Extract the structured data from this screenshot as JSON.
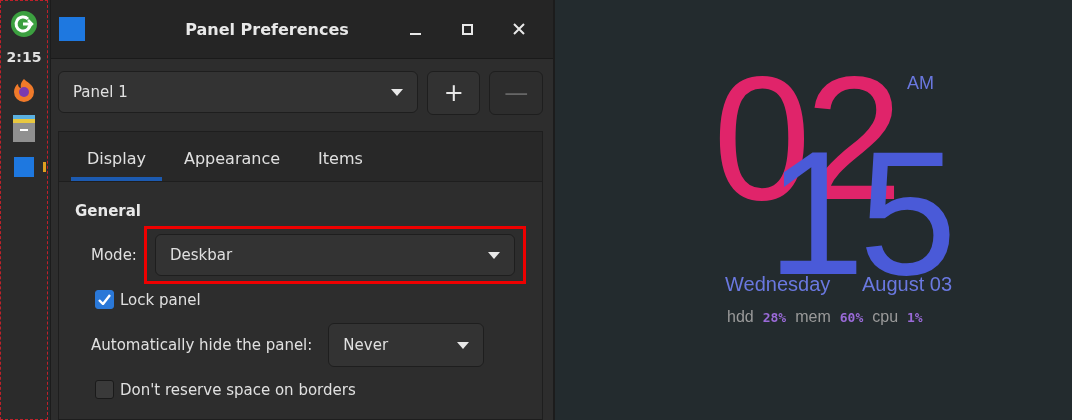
{
  "taskbar": {
    "clock": "2:15"
  },
  "window": {
    "title": "Panel Preferences",
    "panel_select": {
      "value": "Panel 1"
    },
    "add_button": {
      "label": "+",
      "disabled": false
    },
    "remove_button": {
      "label": "—",
      "disabled": true
    },
    "tabs": [
      {
        "label": "Display",
        "selected": true
      },
      {
        "label": "Appearance",
        "selected": false
      },
      {
        "label": "Items",
        "selected": false
      }
    ],
    "section": "General",
    "mode": {
      "label": "Mode:",
      "value": "Deskbar",
      "highlighted": true
    },
    "lock_panel": {
      "label": "Lock panel",
      "checked": true
    },
    "autohide": {
      "label": "Automatically hide the panel:",
      "value": "Never"
    },
    "reserve_space": {
      "label": "Don't reserve space on borders",
      "checked": false
    }
  },
  "clock_widget": {
    "hour": "02",
    "minute": "15",
    "ampm": "AM",
    "weekday": "Wednesday",
    "date": "August 03",
    "stats": [
      {
        "label": "hdd",
        "value": "28%"
      },
      {
        "label": "mem",
        "value": "60%"
      },
      {
        "label": "cpu",
        "value": "1%"
      }
    ]
  }
}
